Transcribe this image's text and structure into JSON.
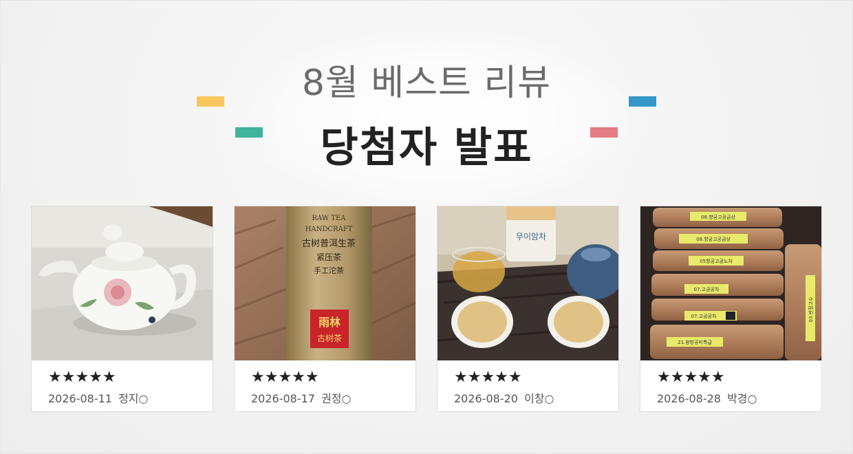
{
  "headline": {
    "line1": "8월 베스트 리뷰",
    "line2": "당첨자 발표"
  },
  "accents": {
    "yellow": "#f7c65c",
    "teal": "#40b39c",
    "blue": "#3597c8",
    "pink": "#e67b83"
  },
  "reviews": [
    {
      "photo": "white-porcelain-teapot-photo",
      "stars": "★★★★★",
      "date": "2026-08-11",
      "name": "정지○"
    },
    {
      "photo": "pu-erh-tea-package-photo",
      "package_text": [
        "RAW TEA",
        "HANDCRAFT",
        "古树普洱生茶",
        "紧压茶",
        "手工沱茶"
      ],
      "seal_text": [
        "雨林",
        "古树茶"
      ],
      "stars": "★★★★★",
      "date": "2026-08-17",
      "name": "권정○"
    },
    {
      "photo": "tea-cups-on-tray-photo",
      "bottle_label": "무이암차",
      "stars": "★★★★★",
      "date": "2026-08-20",
      "name": "이창○"
    },
    {
      "photo": "stacked-tea-boxes-photo",
      "box_labels": [
        "08.향궁고공금상",
        "08.향궁고공금상",
        "05향공고공노차",
        "07.고공공차",
        "07.고공공차",
        "21.왕방공미특급",
        "03.반장고수"
      ],
      "stars": "★★★★★",
      "date": "2026-08-28",
      "name": "박경○"
    }
  ]
}
